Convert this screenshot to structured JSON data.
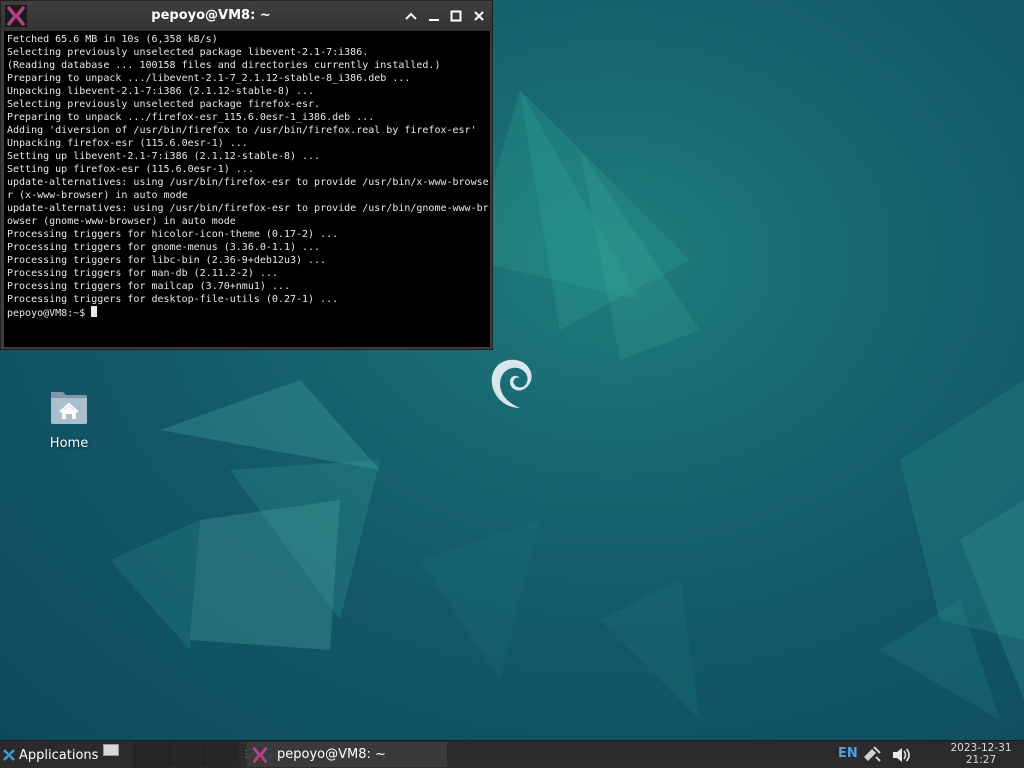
{
  "terminal": {
    "title": "pepoyo@VM8: ~",
    "output_lines": [
      "Fetched 65.6 MB in 10s (6,358 kB/s)",
      "Selecting previously unselected package libevent-2.1-7:i386.",
      "(Reading database ... 100158 files and directories currently installed.)",
      "Preparing to unpack .../libevent-2.1-7_2.1.12-stable-8_i386.deb ...",
      "Unpacking libevent-2.1-7:i386 (2.1.12-stable-8) ...",
      "Selecting previously unselected package firefox-esr.",
      "Preparing to unpack .../firefox-esr_115.6.0esr-1_i386.deb ...",
      "Adding 'diversion of /usr/bin/firefox to /usr/bin/firefox.real by firefox-esr'",
      "Unpacking firefox-esr (115.6.0esr-1) ...",
      "Setting up libevent-2.1-7:i386 (2.1.12-stable-8) ...",
      "Setting up firefox-esr (115.6.0esr-1) ...",
      "update-alternatives: using /usr/bin/firefox-esr to provide /usr/bin/x-www-browse",
      "r (x-www-browser) in auto mode",
      "update-alternatives: using /usr/bin/firefox-esr to provide /usr/bin/gnome-www-br",
      "owser (gnome-www-browser) in auto mode",
      "Processing triggers for hicolor-icon-theme (0.17-2) ...",
      "Processing triggers for gnome-menus (3.36.0-1.1) ...",
      "Processing triggers for libc-bin (2.36-9+deb12u3) ...",
      "Processing triggers for man-db (2.11.2-2) ...",
      "Processing triggers for mailcap (3.70+nmu1) ...",
      "Processing triggers for desktop-file-utils (0.27-1) ..."
    ],
    "prompt": "pepoyo@VM8:~$ "
  },
  "desktop": {
    "home_label": "Home"
  },
  "taskbar": {
    "applications_label": "Applications",
    "task_terminal_label": "pepoyo@VM8: ~",
    "keyboard_layout": "EN",
    "clock_date": "2023-12-31",
    "clock_time": "21:27"
  },
  "colors": {
    "terminal_bg": "#000000",
    "terminal_fg": "#e8e8e8",
    "taskbar_bg": "#2b2b2b",
    "kbd_layout": "#4da3e0",
    "desktop_teal": "#186a72"
  }
}
